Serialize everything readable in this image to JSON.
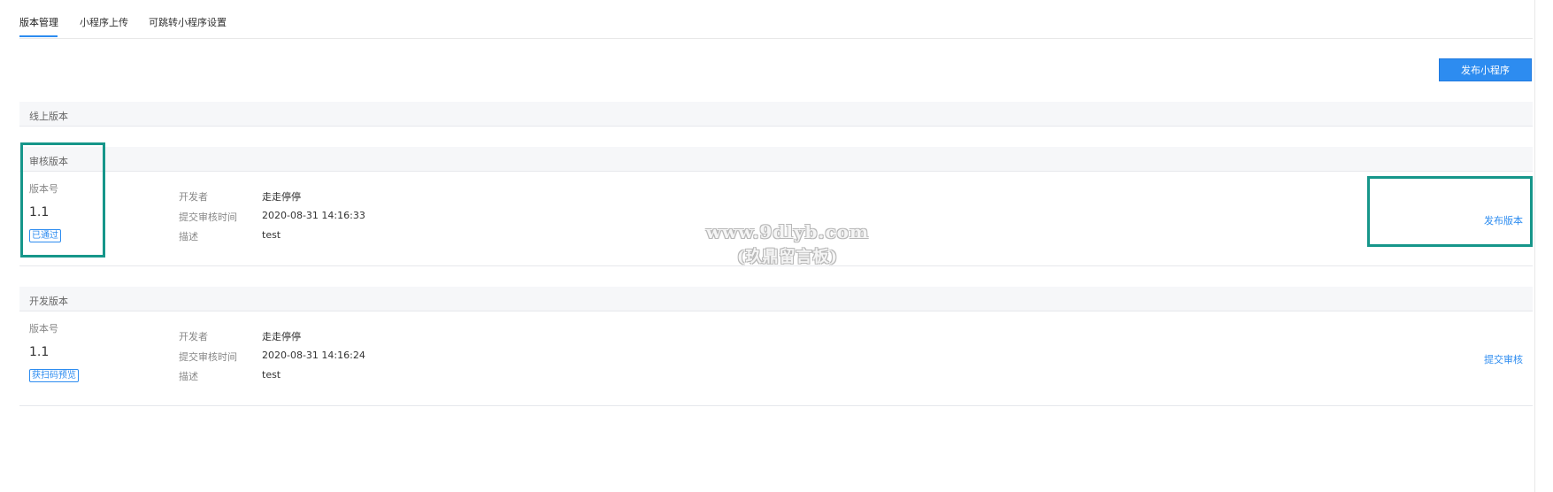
{
  "tabs": [
    {
      "label": "版本管理",
      "active": true
    },
    {
      "label": "小程序上传",
      "active": false
    },
    {
      "label": "可跳转小程序设置",
      "active": false
    }
  ],
  "toolbar": {
    "publish_label": "发布小程序"
  },
  "sections": {
    "online": {
      "title": "线上版本"
    },
    "review": {
      "title": "审核版本",
      "version_label": "版本号",
      "version": "1.1",
      "badge": "已通过",
      "developer_label": "开发者",
      "developer": "走走停停",
      "time_label": "提交审核时间",
      "time": "2020-08-31 14:16:33",
      "desc_label": "描述",
      "desc": "test",
      "action": "发布版本"
    },
    "dev": {
      "title": "开发版本",
      "version_label": "版本号",
      "version": "1.1",
      "badge": "获扫码预览",
      "developer_label": "开发者",
      "developer": "走走停停",
      "time_label": "提交审核时间",
      "time": "2020-08-31 14:16:24",
      "desc_label": "描述",
      "desc": "test",
      "action": "提交审核"
    }
  },
  "watermark": {
    "line1": "www.9dlyb.com",
    "line2": "(玖鼎留言板)"
  },
  "colors": {
    "accent": "#2d8cf0",
    "highlight": "#16968a",
    "section_bg": "#f6f7f9"
  }
}
